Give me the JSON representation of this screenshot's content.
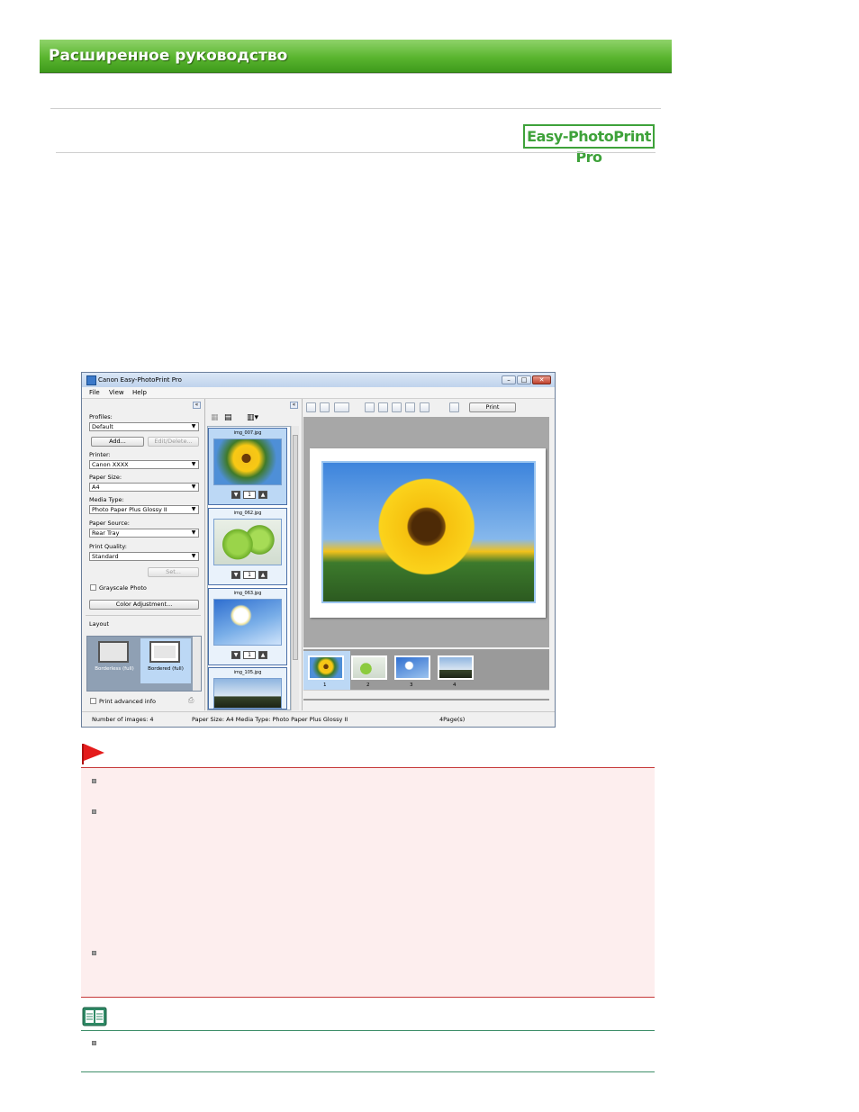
{
  "header": {
    "title": "Расширенное руководство"
  },
  "product_logo": "Easy-PhotoPrint Pro",
  "app": {
    "title": "Canon Easy-PhotoPrint Pro",
    "menu": [
      "File",
      "View",
      "Help"
    ],
    "left_panel": {
      "profiles_label": "Profiles:",
      "profiles_value": "Default",
      "add_button": "Add...",
      "edit_delete_button": "Edit/Delete...",
      "printer_label": "Printer:",
      "printer_value": "Canon XXXX",
      "paper_size_label": "Paper Size:",
      "paper_size_value": "A4",
      "media_type_label": "Media Type:",
      "media_type_value": "Photo Paper Plus Glossy II",
      "paper_source_label": "Paper Source:",
      "paper_source_value": "Rear Tray",
      "print_quality_label": "Print Quality:",
      "print_quality_value": "Standard",
      "set_button": "Set...",
      "grayscale_label": "Grayscale Photo",
      "color_adjustment_button": "Color Adjustment...",
      "layout_label": "Layout",
      "layout_options": [
        "Borderless (full)",
        "Bordered (full)"
      ],
      "print_advanced_info": "Print advanced info"
    },
    "thumbnails": [
      {
        "filename": "img_007.jpg",
        "count": "1"
      },
      {
        "filename": "img_062.jpg",
        "count": "1"
      },
      {
        "filename": "img_063.jpg",
        "count": "1"
      },
      {
        "filename": "img_105.jpg",
        "count": ""
      }
    ],
    "print_button": "Print",
    "pages": [
      "1",
      "2",
      "3",
      "4"
    ],
    "status": {
      "images": "Number of images: 4",
      "paper": "Paper Size: A4  Media Type: Photo Paper Plus Glossy II",
      "pages": "4Page(s)"
    }
  },
  "colors": {
    "banner": "#5ab52f",
    "important_border": "#c63a3a",
    "note_border": "#3f8f6a",
    "logo": "#3ea23a"
  }
}
